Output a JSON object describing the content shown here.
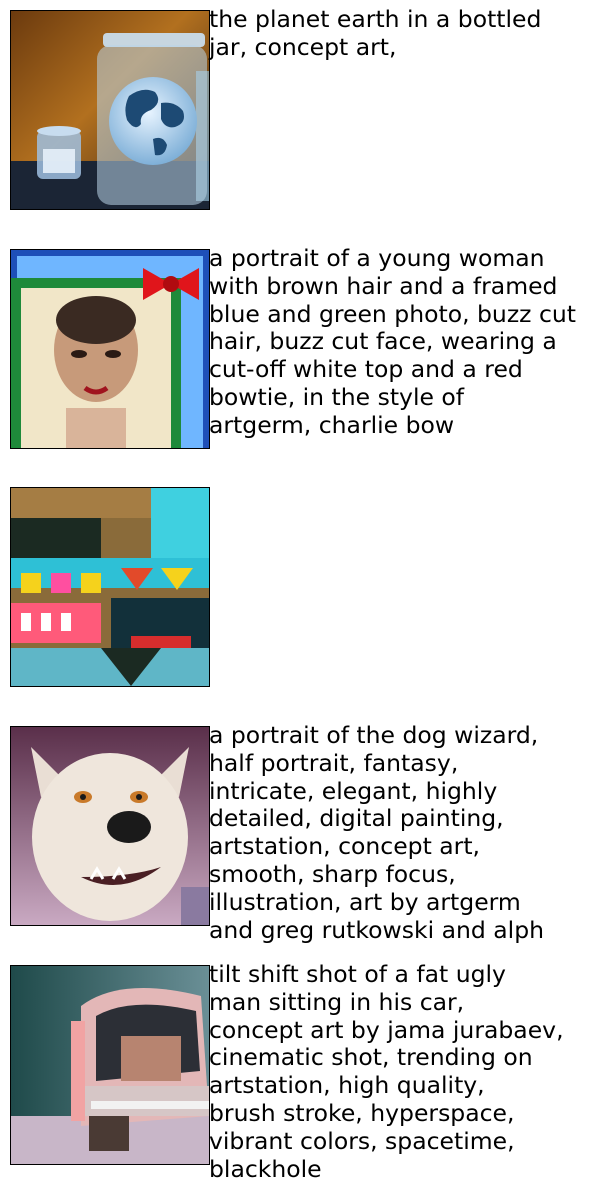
{
  "items": [
    {
      "image": "glass-jar-with-earth-globe",
      "caption": "the planet earth in a bottled\njar, concept art,"
    },
    {
      "image": "framed-portrait-buzz-cut-woman-red-bow",
      "caption": "a portrait of a young woman\nwith brown hair and a framed\nblue and green photo, buzz cut\nhair, buzz cut face, wearing a\ncut-off white top and a red\nbowtie, in the style of\nartgerm, charlie bow"
    },
    {
      "image": "abstract-colorful-pattern",
      "caption": ""
    },
    {
      "image": "white-wolf-dog-portrait",
      "caption": "a portrait of the dog wizard,\nhalf portrait, fantasy,\nintricate, elegant, highly\ndetailed, digital painting,\nartstation, concept art,\nsmooth, sharp focus,\nillustration, art by artgerm\nand greg rutkowski and alph"
    },
    {
      "image": "retro-car-rear-view",
      "caption": "tilt shift shot of a fat ugly\nman sitting in his car,\nconcept art by jama jurabaev,\ncinematic shot, trending on\nartstation, high quality,\nbrush stroke, hyperspace,\nvibrant colors, spacetime,\nblackhole"
    }
  ]
}
